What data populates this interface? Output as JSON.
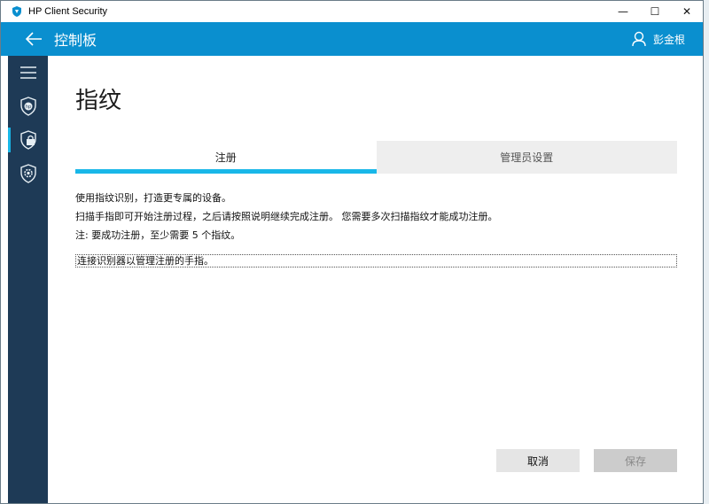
{
  "window": {
    "title": "HP Client Security",
    "controls": {
      "minimize": "—",
      "maximize": "☐",
      "close": "✕"
    }
  },
  "appbar": {
    "title": "控制板",
    "user_name": "彭金根"
  },
  "sidebar": {
    "items": [
      {
        "icon": "hamburger-menu-icon"
      },
      {
        "icon": "hp-shield-icon"
      },
      {
        "icon": "lock-shield-icon",
        "active": true
      },
      {
        "icon": "gear-shield-icon"
      }
    ]
  },
  "main": {
    "heading": "指纹",
    "tabs": [
      {
        "label": "注册",
        "active": true
      },
      {
        "label": "管理员设置",
        "active": false
      }
    ],
    "description": [
      "使用指纹识别，打造更专属的设备。",
      "扫描手指即可开始注册过程，之后请按照说明继续完成注册。 您需要多次扫描指纹才能成功注册。",
      "注:  要成功注册，至少需要 5 个指纹。"
    ],
    "reader_prompt": "连接识别器以管理注册的手指。",
    "buttons": {
      "cancel": "取消",
      "save": "保存"
    }
  },
  "colors": {
    "accent": "#0a8fcf",
    "sidebar": "#1e3a56",
    "tab_indicator": "#18b7e8"
  }
}
